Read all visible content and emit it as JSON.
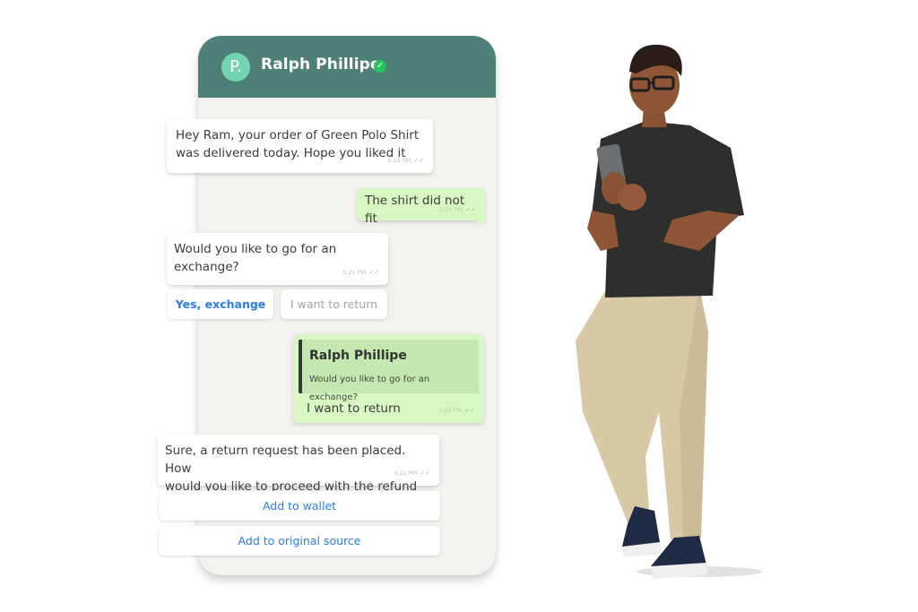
{
  "chat": {
    "contact": {
      "name": "Ralph Phillipe",
      "avatar_initial": "P.",
      "verified": true,
      "avatar_color": "#73d3b3",
      "header_color": "#4d8177"
    },
    "messages": [
      {
        "direction": "incoming",
        "text_lines": [
          "Hey Ram, your order of Green Polo Shirt",
          "was delivered today. Hope you liked it"
        ],
        "time": "5:19 PM",
        "status": "read"
      },
      {
        "direction": "outgoing",
        "text": "The shirt did not fit",
        "time": "5:20 PM",
        "status": "read"
      },
      {
        "direction": "incoming",
        "text_lines": [
          "Would you like to go for an",
          "exchange?"
        ],
        "time": "5:21 PM",
        "status": "read",
        "quick_replies": [
          "Yes, exchange",
          "I want to return"
        ]
      },
      {
        "direction": "outgoing",
        "quoted": {
          "name": "Ralph Phillipe",
          "text": "Would you like to go for an exchange?"
        },
        "text": "I want to return",
        "time": "5:22 PM",
        "status": "read"
      },
      {
        "direction": "incoming",
        "text_lines": [
          "Sure, a return request has been placed. How",
          "would you like to proceed with the refund"
        ],
        "time": "5:22 PM",
        "status": "read",
        "quick_replies": [
          "Add to wallet",
          "Add to original source"
        ]
      }
    ],
    "colors": {
      "incoming_bubble": "#ffffff",
      "outgoing_bubble": "#d8f7c3",
      "chat_background": "#f4f2ee",
      "button_text": "#2b7de9",
      "verified_badge": "#22c55e"
    }
  },
  "illustration": {
    "subject": "person holding phone",
    "shirt_color": "#2e2f2d",
    "pants_color": "#d8c9a6",
    "shoes_color": "#1f2a44"
  }
}
